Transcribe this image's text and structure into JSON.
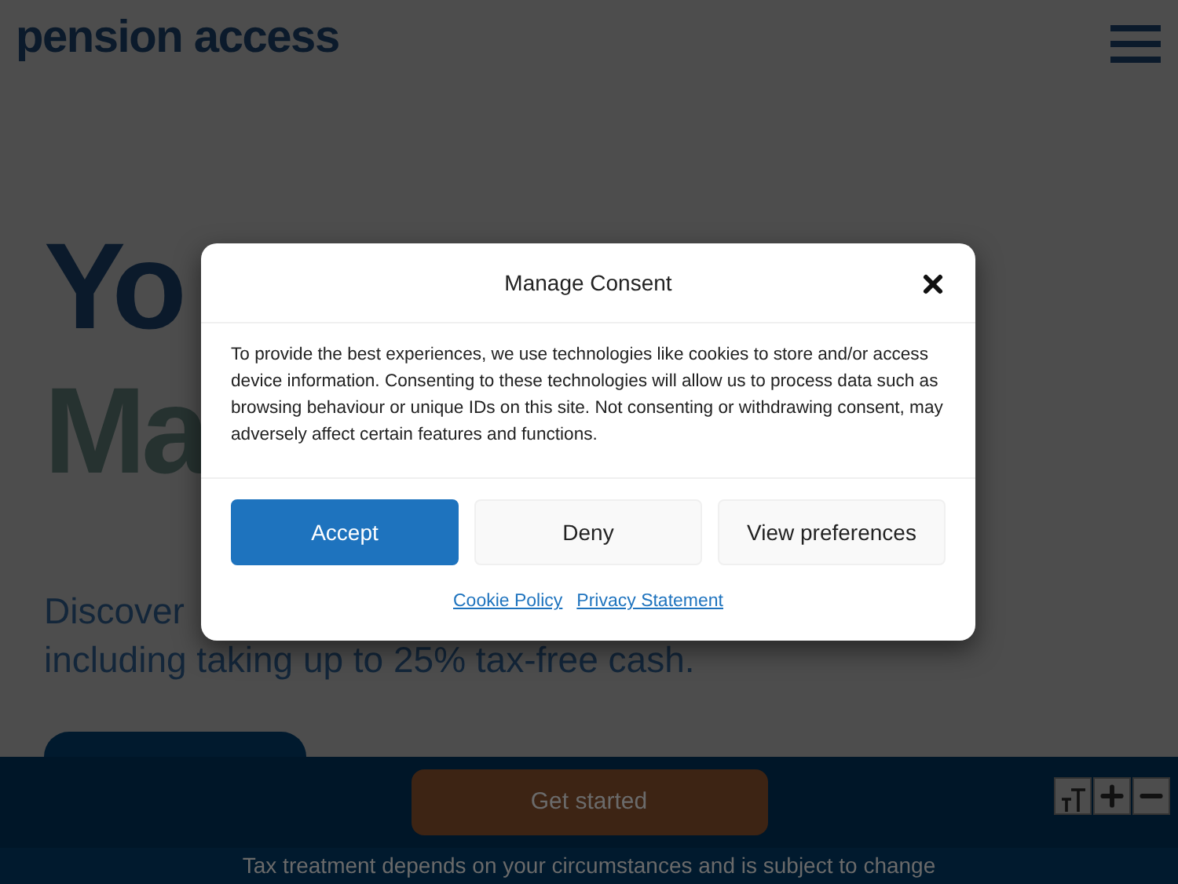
{
  "header": {
    "logo": "pension access"
  },
  "hero": {
    "heading_lines": [
      "Yo",
      "Ma"
    ],
    "intro_lines": [
      "Discover",
      "including taking up to 25% tax-free cash."
    ]
  },
  "sticky_bar": {
    "button": "Get started",
    "notice": "Tax treatment depends on your circumstances and is subject to change"
  },
  "consent_dialog": {
    "title": "Manage Consent",
    "body": "To provide the best experiences, we use technologies like cookies to store and/or access device information. Consenting to these technologies will allow us to process data such as browsing behaviour or unique IDs on this site. Not consenting or withdrawing consent, may adversely affect certain features and functions.",
    "buttons": [
      {
        "label": "Accept",
        "kind": "primary"
      },
      {
        "label": "Deny",
        "kind": "secondary"
      },
      {
        "label": "View preferences",
        "kind": "secondary"
      }
    ],
    "links": [
      "Cookie Policy",
      "Privacy Statement"
    ]
  }
}
